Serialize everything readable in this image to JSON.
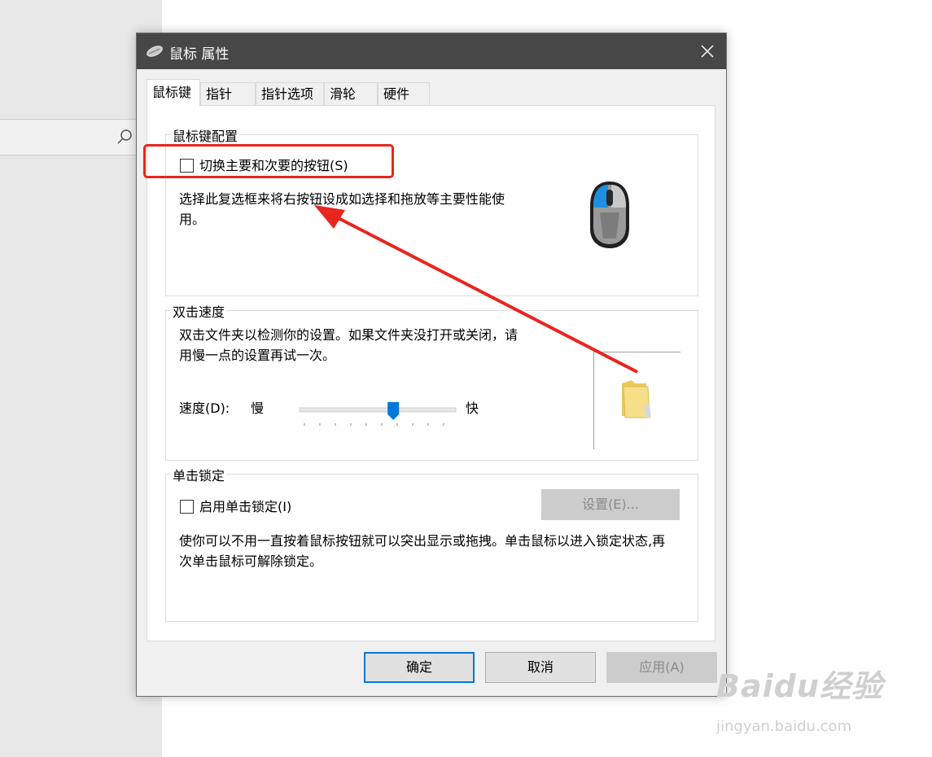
{
  "dialog": {
    "title": "鼠标 属性",
    "tabs": [
      "鼠标键",
      "指针",
      "指针选项",
      "滑轮",
      "硬件"
    ],
    "button_config": {
      "group_title": "鼠标键配置",
      "swap_checkbox_label": "切换主要和次要的按钮(S)",
      "swap_checked": false,
      "description": "选择此复选框来将右按钮设成如选择和拖放等主要性能使用。"
    },
    "double_click": {
      "group_title": "双击速度",
      "description": "双击文件夹以检测你的设置。如果文件夹没打开或关闭，请用慢一点的设置再试一次。",
      "speed_label": "速度(D):",
      "slow_label": "慢",
      "fast_label": "快",
      "speed_fraction": 0.6
    },
    "click_lock": {
      "group_title": "单击锁定",
      "checkbox_label": "启用单击锁定(I)",
      "checked": false,
      "settings_button": "设置(E)...",
      "description": "使你可以不用一直按着鼠标按钮就可以突出显示或拖拽。单击鼠标以进入锁定状态,再次单击鼠标可解除锁定。"
    },
    "buttons": {
      "ok": "确定",
      "cancel": "取消",
      "apply": "应用(A)"
    }
  },
  "watermark": {
    "logo": "Baidu经验",
    "url": "jingyan.baidu.com"
  },
  "colors": {
    "annotation_red": "#e8251f",
    "accent_blue": "#0078d7",
    "titlebar": "#474747"
  }
}
